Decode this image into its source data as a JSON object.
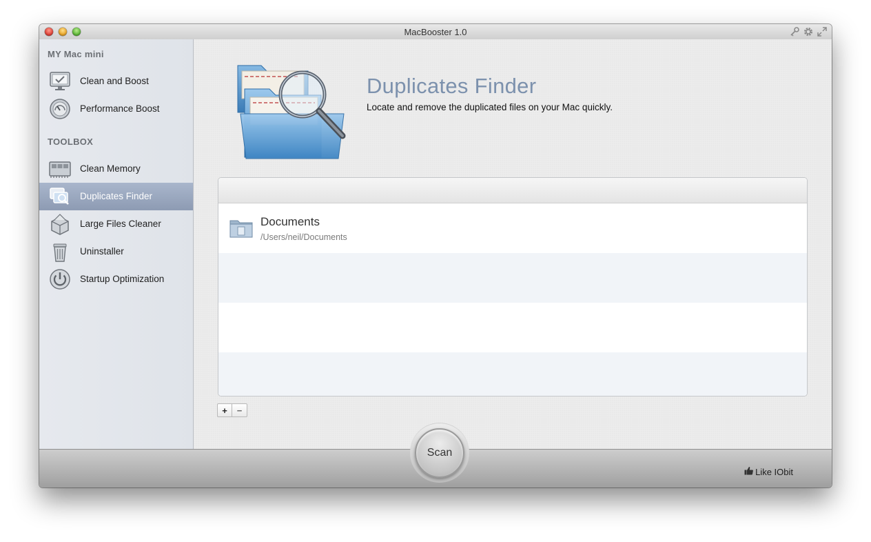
{
  "window": {
    "title": "MacBooster 1.0"
  },
  "sidebar": {
    "section_mymac": "MY Mac mini",
    "section_toolbox": "TOOLBOX",
    "items": [
      {
        "label": "Clean and Boost",
        "icon": "monitor-check-icon",
        "active": false
      },
      {
        "label": "Performance Boost",
        "icon": "speedometer-icon",
        "active": false
      },
      {
        "label": "Clean Memory",
        "icon": "memory-chip-icon",
        "active": false
      },
      {
        "label": "Duplicates Finder",
        "icon": "duplicates-icon",
        "active": true
      },
      {
        "label": "Large Files Cleaner",
        "icon": "box-icon",
        "active": false
      },
      {
        "label": "Uninstaller",
        "icon": "trash-icon",
        "active": false
      },
      {
        "label": "Startup Optimization",
        "icon": "power-icon",
        "active": false
      }
    ]
  },
  "main": {
    "title": "Duplicates Finder",
    "subtitle": "Locate and remove the duplicated files on your Mac quickly.",
    "hero_icon": "folders-magnifier-icon",
    "folders": [
      {
        "name": "Documents",
        "path": "/Users/neil/Documents",
        "icon": "folder-icon"
      }
    ],
    "add_label": "+",
    "remove_label": "−"
  },
  "bottom": {
    "scan_label": "Scan",
    "like_label": "Like IObit",
    "like_icon": "thumbs-up-icon"
  },
  "colors": {
    "accent_title": "#7c91ad",
    "sidebar_active": "#98a6be"
  }
}
